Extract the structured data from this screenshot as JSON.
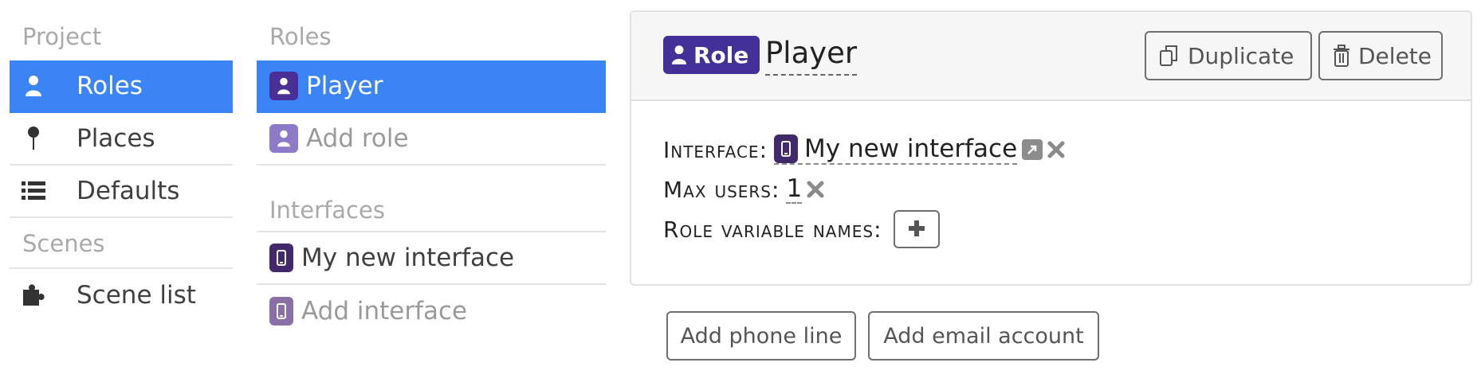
{
  "left_nav": {
    "project_header": "Project",
    "items": [
      {
        "label": "Roles",
        "icon": "person-icon",
        "active": true
      },
      {
        "label": "Places",
        "icon": "pin-icon",
        "active": false
      },
      {
        "label": "Defaults",
        "icon": "list-icon",
        "active": false
      }
    ],
    "scenes_header": "Scenes",
    "scene_items": [
      {
        "label": "Scene list",
        "icon": "puzzle-icon"
      }
    ]
  },
  "mid_nav": {
    "roles_header": "Roles",
    "roles": [
      {
        "label": "Player",
        "active": true
      },
      {
        "label": "Add role",
        "active": false
      }
    ],
    "interfaces_header": "Interfaces",
    "interfaces": [
      {
        "label": "My new interface"
      },
      {
        "label": "Add interface"
      }
    ]
  },
  "panel": {
    "badge_label": "Role",
    "role_name": "Player",
    "duplicate_label": "Duplicate",
    "delete_label": "Delete",
    "interface_label": "Interface:",
    "interface_value": "My new interface",
    "max_users_label": "Max users:",
    "max_users_value": "1",
    "role_vars_label": "Role variable names:"
  },
  "actions": {
    "add_phone_label": "Add phone line",
    "add_email_label": "Add email account"
  },
  "colors": {
    "accent": "#3a84f5",
    "role_badge": "#45309a",
    "interface_badge": "#42296b"
  }
}
